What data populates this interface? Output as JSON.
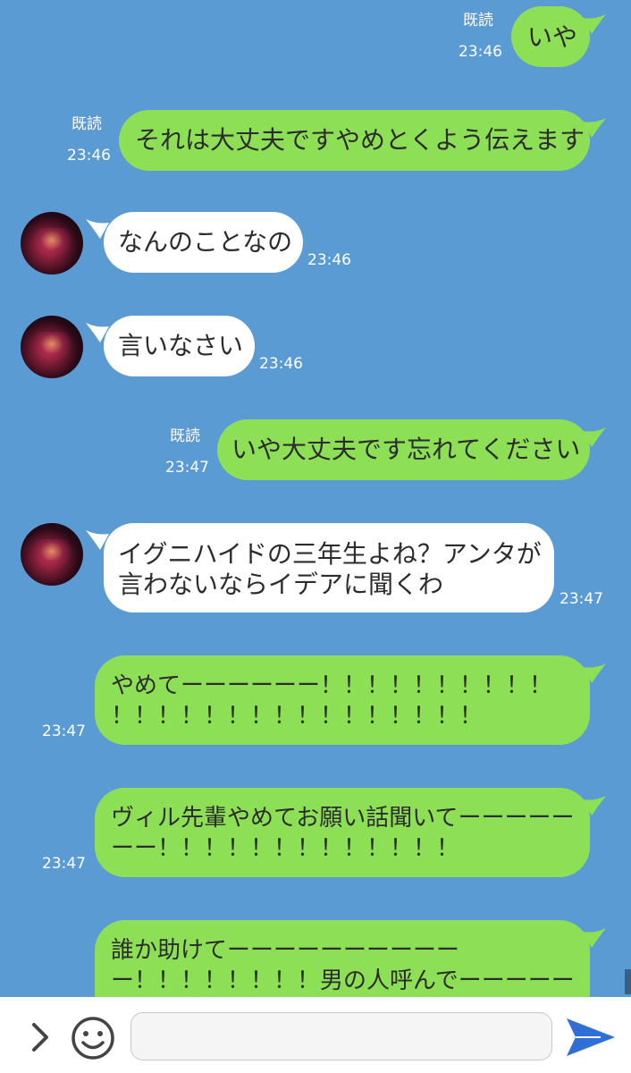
{
  "messages": [
    {
      "id": "m1",
      "text": "いや",
      "read": "既読",
      "time": "23:46"
    },
    {
      "id": "m2",
      "text": "それは大丈夫ですやめとくよう伝えます",
      "read": "既読",
      "time": "23:46"
    },
    {
      "id": "m3",
      "text": "なんのことなの",
      "time": "23:46"
    },
    {
      "id": "m4",
      "text": "言いなさい",
      "time": "23:46"
    },
    {
      "id": "m5",
      "text": "いや大丈夫です忘れてください",
      "read": "既読",
      "time": "23:47"
    },
    {
      "id": "m6",
      "lines": [
        "イグニハイドの三年生よね？アンタが",
        "言わないならイデアに聞くわ"
      ],
      "time": "23:47"
    },
    {
      "id": "m7",
      "lines": [
        "やめてーーーーーー！！！！！！！！！！",
        "！！！！！！！！！！！！！！！！"
      ],
      "time": "23:47"
    },
    {
      "id": "m8",
      "lines": [
        "ヴィル先輩やめてお願い話聞いてーーーーー",
        "ーー！！！！！！！！！！！！！"
      ],
      "time": "23:47"
    },
    {
      "id": "m9",
      "lines": [
        "誰か助けてーーーーーーーーーー",
        "ー！！！！！！！！男の人呼んでーーーーー"
      ]
    }
  ],
  "input": {
    "value": "",
    "placeholder": ""
  },
  "icons": {
    "expand": "chevron-right-icon",
    "emoji": "smiley-icon",
    "send": "send-arrow-icon"
  },
  "colors": {
    "background": "#5b9bd3",
    "outgoing_bubble": "#8de055",
    "incoming_bubble": "#ffffff",
    "send_icon": "#2f6fd6"
  }
}
